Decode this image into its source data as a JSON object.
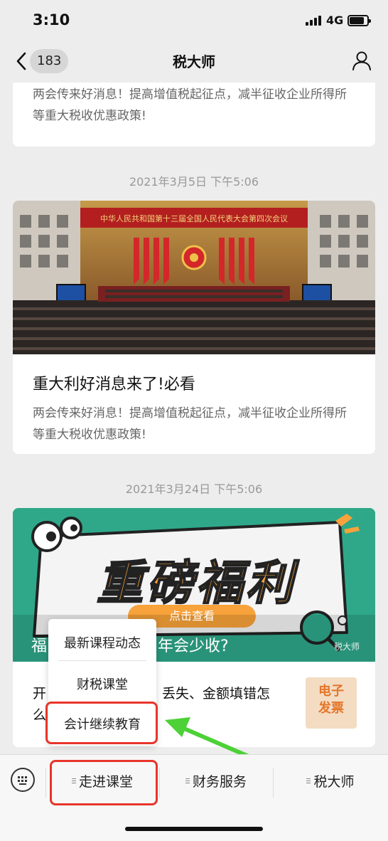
{
  "status_bar": {
    "time": "3:10",
    "network": "4G"
  },
  "nav": {
    "unread_count": "183",
    "title": "税大师"
  },
  "feed": {
    "top_card": {
      "desc": "两会传来好消息！提高增值税起征点，减半征收企业所得所等重大税收优惠政策!"
    },
    "timestamp_1": "2021年3月5日 下午5:06",
    "article_1": {
      "banner_text": "中华人民共和国第十三届全国人民代表大会第四次会议",
      "title": "重大利好消息来了!必看",
      "desc": "两会传来好消息！提高增值税起征点，减半征收企业所得所等重大税收优惠政策!"
    },
    "timestamp_2": "2021年3月24日 下午5:06",
    "article_2": {
      "promo_text": "重磅福利",
      "promo_button": "点击查看",
      "title_visible_start": "福",
      "title_visible_end": "年会少收?",
      "watermark": "税大师",
      "sub_item_start": "开",
      "sub_item_line1_end": "丢失、金额填错怎",
      "sub_item_line2_start": "么",
      "thumb_text": "电子发票"
    }
  },
  "menu": {
    "items": [
      {
        "label": "最新课程动态"
      },
      {
        "label": "财税课堂"
      },
      {
        "label": "会计继续教育"
      }
    ]
  },
  "bottom_bar": {
    "tabs": [
      {
        "label": "走进课堂"
      },
      {
        "label": "财务服务"
      },
      {
        "label": "税大师"
      }
    ]
  },
  "colors": {
    "highlight": "#e8352b",
    "arrow": "#4cd137",
    "promo_bg": "#2fa88a",
    "promo_text": "#f7a23a"
  }
}
